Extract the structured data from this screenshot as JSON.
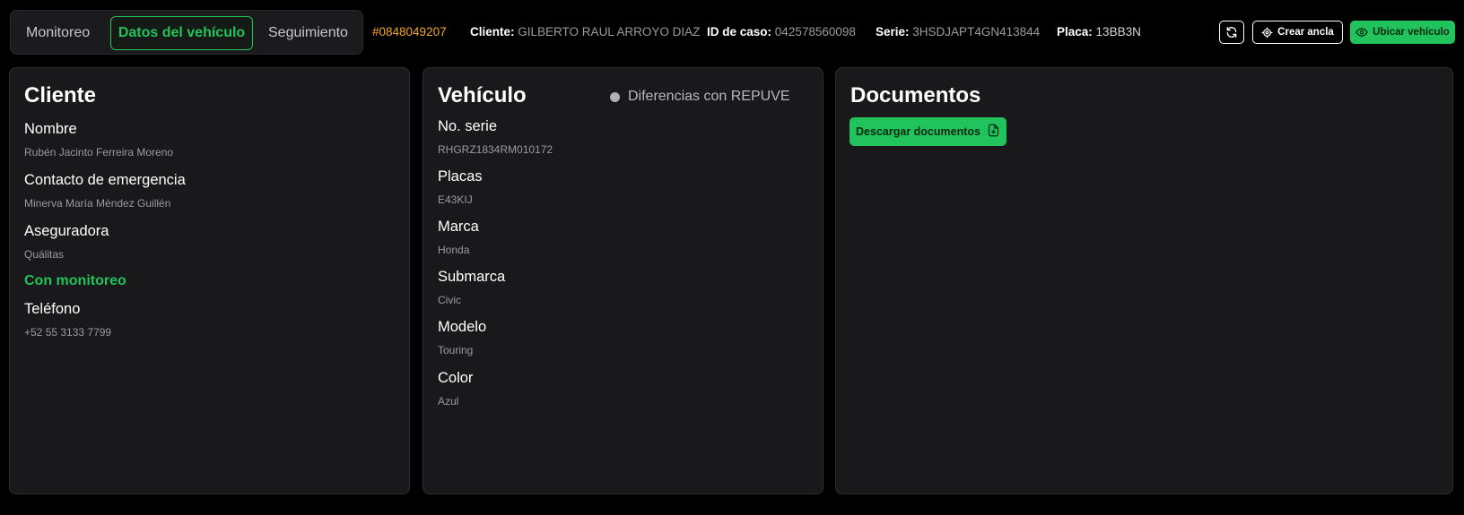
{
  "tabs": [
    {
      "label": "Monitoreo"
    },
    {
      "label": "Datos del vehículo"
    },
    {
      "label": "Seguimiento"
    }
  ],
  "header": {
    "case_number": "#0848049207",
    "client_key": "Cliente:",
    "client_value": "GILBERTO RAUL ARROYO DIAZ",
    "case_id_key": "ID de caso:",
    "case_id_value": "042578560098",
    "serie_key": "Serie:",
    "serie_value": "3HSDJAPT4GN413844",
    "placa_key": "Placa:",
    "placa_value": "13BB3N"
  },
  "actions": {
    "refresh_icon": "refresh-icon",
    "create_anchor_label": "Crear ancla",
    "locate_vehicle_label": "Ubicar vehículo"
  },
  "client_card": {
    "title": "Cliente",
    "name_label": "Nombre",
    "name_value": "Rubén Jacinto Ferreira Moreno",
    "emergency_label": "Contacto de emergencia",
    "emergency_value": "Minerva María Méndez Guillén",
    "insurer_label": "Aseguradora",
    "insurer_value": "Quálitas",
    "monitoring_status": "Con monitoreo",
    "phone_label": "Teléfono",
    "phone_value": "+52 55 3133 7799"
  },
  "vehicle_card": {
    "title": "Vehículo",
    "repuve_label": "Diferencias con REPUVE",
    "fields": [
      {
        "label": "No. serie",
        "value": "RHGRZ1834RM010172"
      },
      {
        "label": "Placas",
        "value": "E43KIJ"
      },
      {
        "label": "Marca",
        "value": "Honda"
      },
      {
        "label": "Submarca",
        "value": "Civic"
      },
      {
        "label": "Modelo",
        "value": "Touring"
      },
      {
        "label": "Color",
        "value": "Azul"
      }
    ]
  },
  "documents_card": {
    "title": "Documentos",
    "download_label": "Descargar documentos"
  },
  "colors": {
    "accent_green": "#21c35c",
    "case_orange": "#f2a529",
    "card_bg": "#19191b",
    "page_bg": "#000000"
  }
}
